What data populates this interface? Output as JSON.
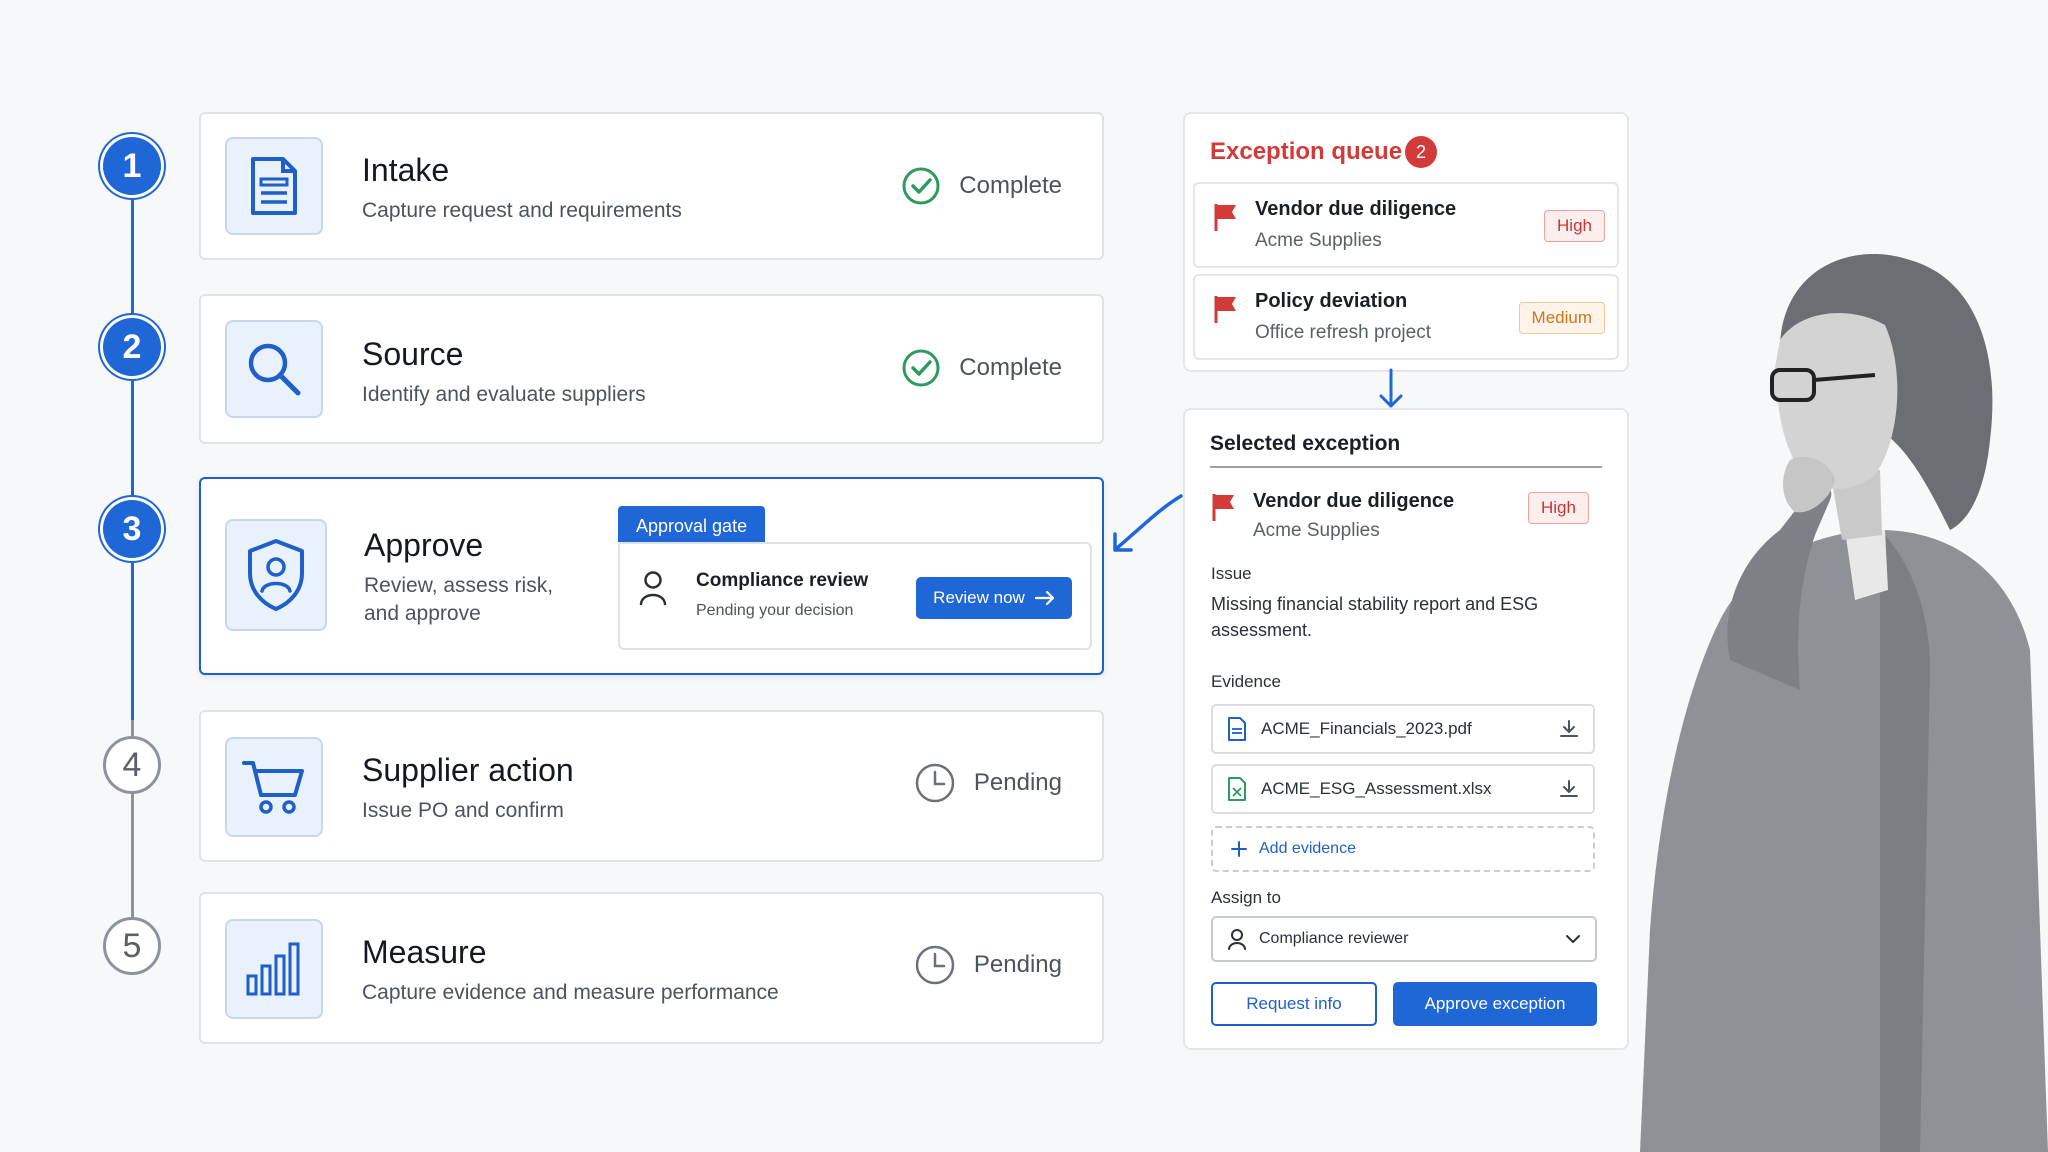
{
  "steps": [
    {
      "num": "1",
      "title": "Intake",
      "subtitle": "Capture request and requirements",
      "status": "Complete",
      "icon": "document-icon"
    },
    {
      "num": "2",
      "title": "Source",
      "subtitle": "Identify and evaluate suppliers",
      "status": "Complete",
      "icon": "search-icon"
    },
    {
      "num": "3",
      "title": "Approve",
      "subtitle_line1": "Review, assess risk,",
      "subtitle_line2": "and approve",
      "icon": "shield-user-icon"
    },
    {
      "num": "4",
      "title": "Supplier action",
      "subtitle": "Issue PO and confirm",
      "status": "Pending",
      "icon": "cart-icon"
    },
    {
      "num": "5",
      "title": "Measure",
      "subtitle": "Capture evidence and measure performance",
      "status": "Pending",
      "icon": "bar-chart-icon"
    }
  ],
  "approval_gate": {
    "tab_label": "Approval gate",
    "title": "Compliance review",
    "subtitle": "Pending your decision",
    "button_label": "Review now"
  },
  "exception_queue": {
    "title": "Exception queue",
    "count": "2",
    "items": [
      {
        "title": "Vendor due diligence",
        "subtitle": "Acme Supplies",
        "priority": "High"
      },
      {
        "title": "Policy deviation",
        "subtitle": "Office refresh project",
        "priority": "Medium"
      }
    ]
  },
  "selected_exception": {
    "heading": "Selected exception",
    "title": "Vendor due diligence",
    "subtitle": "Acme Supplies",
    "priority": "High",
    "issue_label": "Issue",
    "issue_line1": "Missing financial stability report and ESG",
    "issue_line2": "assessment.",
    "evidence_label": "Evidence",
    "files": [
      "ACME_Financials_2023.pdf",
      "ACME_ESG_Assessment.xlsx"
    ],
    "add_evidence": "Add evidence",
    "assign_label": "Assign to",
    "assignee": "Compliance reviewer",
    "request_info": "Request info",
    "approve_exception": "Approve exception"
  },
  "colors": {
    "accent": "#1f66d6",
    "complete": "#2e9a5e",
    "danger": "#d33a3a",
    "warning": "#c7781f"
  }
}
